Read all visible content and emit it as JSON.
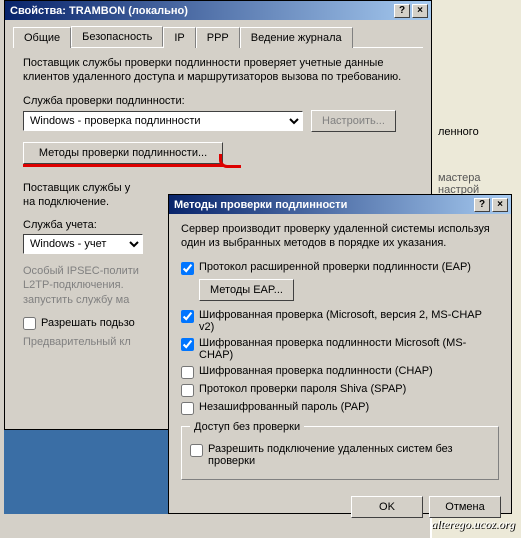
{
  "bg": {
    "line1": "ленного",
    "line2": "мастера настрой"
  },
  "dlg1": {
    "title": "Свойства: TRAMBON (локально)",
    "tabs": [
      "Общие",
      "Безопасность",
      "IP",
      "PPP",
      "Ведение журнала"
    ],
    "desc": "Поставщик службы проверки подлинности проверяет учетные данные клиентов удаленного доступа и маршрутизаторов вызова по требованию.",
    "lbl_auth": "Служба проверки подлинности:",
    "sel_auth": "Windows - проверка подлинности",
    "btn_config": "Настроить...",
    "btn_methods": "Методы проверки подлинности...",
    "desc2_a": "Поставщик службы у",
    "desc2_b": "на подключение.",
    "lbl_acct": "Служба учета:",
    "sel_acct": "Windows - учет",
    "ipsec": "Особый IPSEC-полити\nL2TP-подключения.\nзапустить службу ма",
    "chk_custom": "Разрешать подьзо",
    "key": "Предварительный кл"
  },
  "dlg2": {
    "title": "Методы проверки подлинности",
    "desc": "Сервер производит проверку удаленной системы используя один из выбранных методов в порядке их указания.",
    "eap": "Протокол расширенной проверки подлинности (EAP)",
    "btn_eap": "Методы EAP...",
    "items": [
      {
        "label": "Шифрованная проверка (Microsoft, версия 2, MS-CHAP v2)",
        "checked": true
      },
      {
        "label": "Шифрованная проверка подлинности Microsoft (MS-CHAP)",
        "checked": true
      },
      {
        "label": "Шифрованная проверка подлинности (CHAP)",
        "checked": false
      },
      {
        "label": "Протокол проверки пароля Shiva (SPAP)",
        "checked": false
      },
      {
        "label": "Незашифрованный пароль (PAP)",
        "checked": false
      }
    ],
    "group": "Доступ без проверки",
    "noauth": "Разрешить подключение удаленных систем без проверки",
    "ok": "OK",
    "cancel": "Отмена"
  },
  "watermark": "alterego.ucoz.org"
}
